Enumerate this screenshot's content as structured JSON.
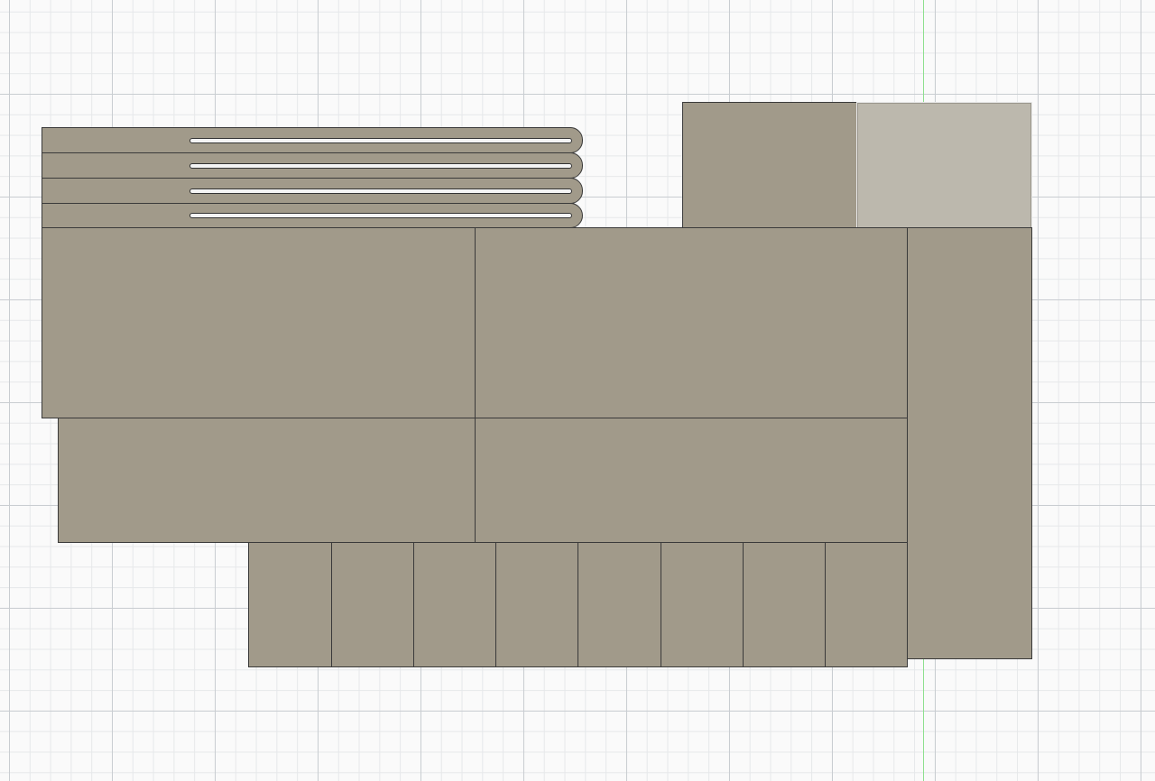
{
  "canvas": {
    "background": "#fafafa",
    "grid_major_color": "#c9cdd1",
    "grid_minor_color": "#e6e8ea",
    "axis_color": "#8ee08e"
  },
  "model": {
    "face_color": "#a19a8a",
    "edge_color": "#3a3a3a",
    "selected_face_color": "#bcb8ad",
    "strip_count": 4,
    "bottom_segment_count": 8
  }
}
